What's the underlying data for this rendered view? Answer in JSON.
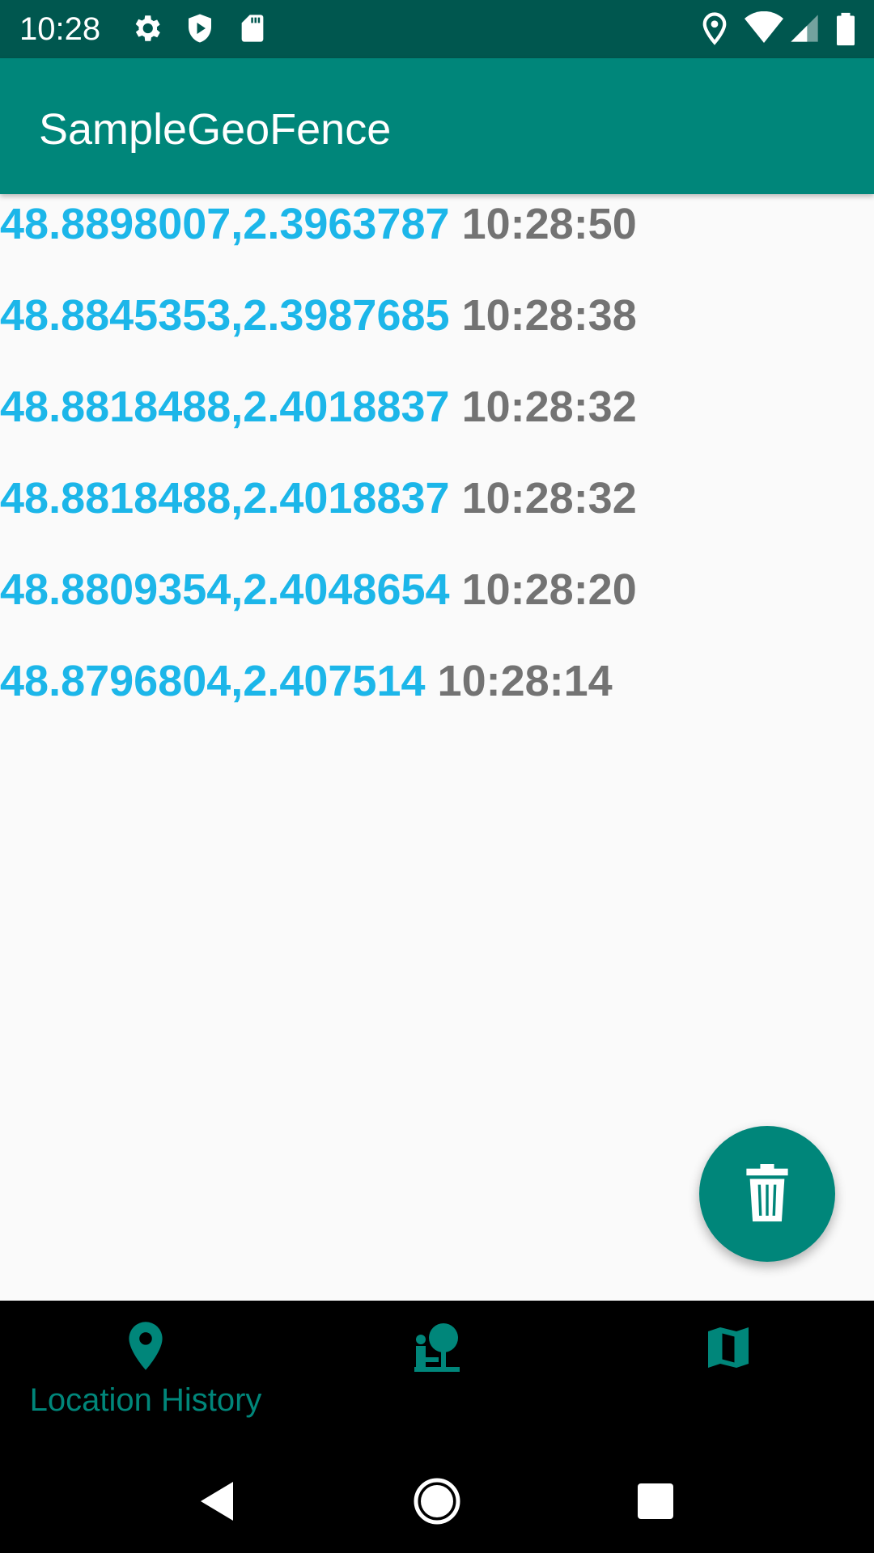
{
  "status_bar": {
    "time": "10:28",
    "left_icons": [
      "gear-icon",
      "shield-icon",
      "sd-card-icon"
    ],
    "right_icons": [
      "location-pin-icon",
      "wifi-icon",
      "signal-icon",
      "battery-icon"
    ]
  },
  "app_bar": {
    "title": "SampleGeoFence",
    "color": "#00867a"
  },
  "locations": [
    {
      "coords": "48.8898007,2.3963787",
      "time": "10:28:50"
    },
    {
      "coords": "48.8845353,2.3987685",
      "time": "10:28:38"
    },
    {
      "coords": "48.8818488,2.4018837",
      "time": "10:28:32"
    },
    {
      "coords": "48.8818488,2.4018837",
      "time": "10:28:32"
    },
    {
      "coords": "48.8809354,2.4048654",
      "time": "10:28:20"
    },
    {
      "coords": "48.8796804,2.407514",
      "time": "10:28:14"
    }
  ],
  "fab": {
    "icon": "trash-icon"
  },
  "bottom_nav": {
    "items": [
      {
        "label": "Location History",
        "icon": "location-pin-icon",
        "selected": true
      },
      {
        "label": "",
        "icon": "person-tree-icon",
        "selected": false
      },
      {
        "label": "",
        "icon": "map-icon",
        "selected": false
      }
    ]
  },
  "system_nav": {
    "buttons": [
      "back-icon",
      "home-icon",
      "recents-icon"
    ]
  },
  "colors": {
    "coords": "#1cb6e9",
    "time": "#737373",
    "accent": "#00867a",
    "status_bar": "#00574f"
  }
}
